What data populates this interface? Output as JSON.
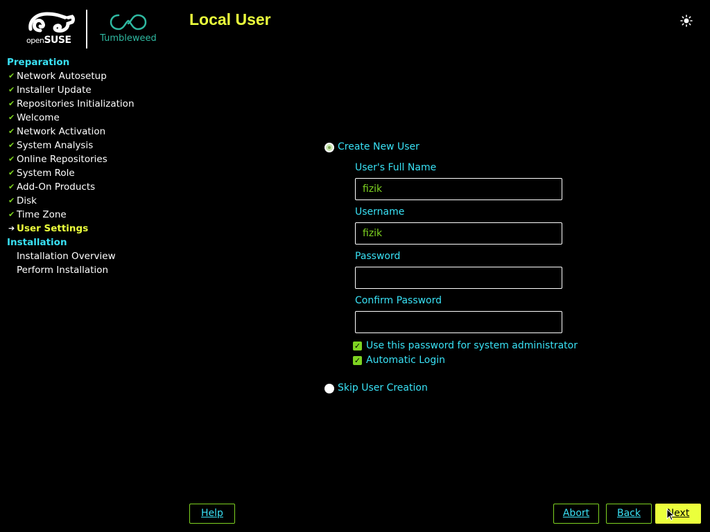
{
  "logos": {
    "suse_prefix": "open",
    "suse_name": "SUSE",
    "tumbleweed": "Tumbleweed"
  },
  "header": {
    "title": "Local User"
  },
  "sidebar": {
    "preparation": {
      "heading": "Preparation",
      "items": [
        {
          "label": "Network Autosetup",
          "state": "done"
        },
        {
          "label": "Installer Update",
          "state": "done"
        },
        {
          "label": "Repositories Initialization",
          "state": "done"
        },
        {
          "label": "Welcome",
          "state": "done"
        },
        {
          "label": "Network Activation",
          "state": "done"
        },
        {
          "label": "System Analysis",
          "state": "done"
        },
        {
          "label": "Online Repositories",
          "state": "done"
        },
        {
          "label": "System Role",
          "state": "done"
        },
        {
          "label": "Add-On Products",
          "state": "done"
        },
        {
          "label": "Disk",
          "state": "done"
        },
        {
          "label": "Time Zone",
          "state": "done"
        },
        {
          "label": "User Settings",
          "state": "current"
        }
      ]
    },
    "installation": {
      "heading": "Installation",
      "items": [
        {
          "label": "Installation Overview",
          "state": "pending"
        },
        {
          "label": "Perform Installation",
          "state": "pending"
        }
      ]
    }
  },
  "form": {
    "create_user": {
      "label": "Create New User",
      "selected": true
    },
    "full_name": {
      "label": "User's Full Name",
      "value": "fizik"
    },
    "username": {
      "label": "Username",
      "value": "fizik"
    },
    "password": {
      "label": "Password",
      "value": ""
    },
    "confirm_password": {
      "label": "Confirm Password",
      "value": ""
    },
    "use_for_admin": {
      "label": "Use this password for system administrator",
      "checked": true
    },
    "auto_login": {
      "label": "Automatic Login",
      "checked": true
    },
    "skip_user": {
      "label": "Skip User Creation",
      "selected": false
    }
  },
  "buttons": {
    "help": "Help",
    "abort": "Abort",
    "back": "Back",
    "next": "Next"
  },
  "colors": {
    "accent_yellow": "#ebff3c",
    "label_cyan": "#39e1f5",
    "check_green": "#7ed321",
    "logo_teal": "#2fb9a1"
  },
  "icons": {
    "theme": "sun-icon",
    "done": "checkmark-icon",
    "current": "arrow-right-icon"
  }
}
